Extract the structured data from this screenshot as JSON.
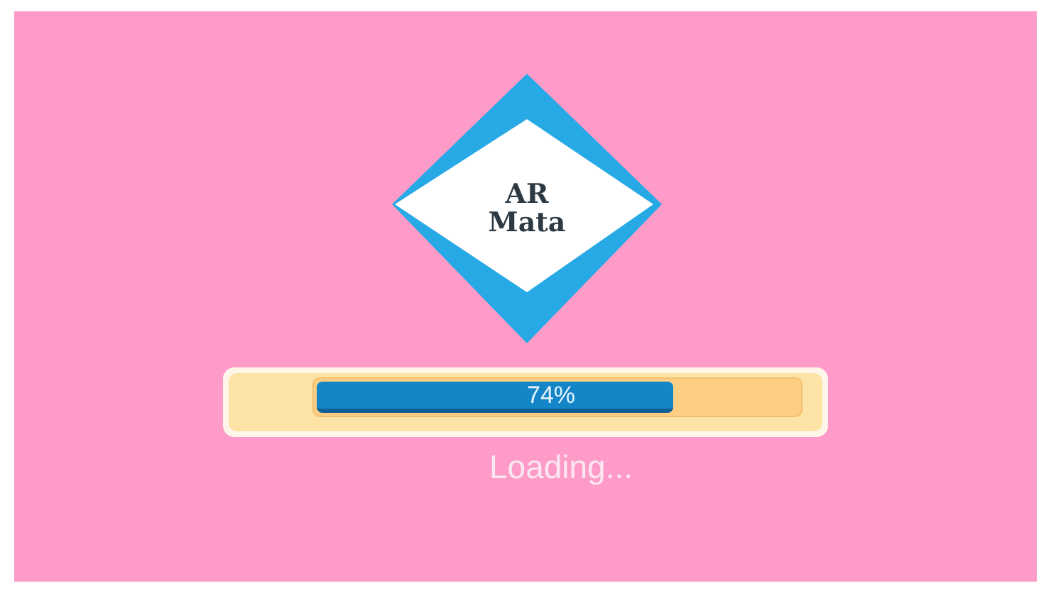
{
  "logo": {
    "lines": [
      "AR",
      "Mata"
    ]
  },
  "progress": {
    "level": 0.74,
    "reading": "74%"
  },
  "status": "Loading..."
}
